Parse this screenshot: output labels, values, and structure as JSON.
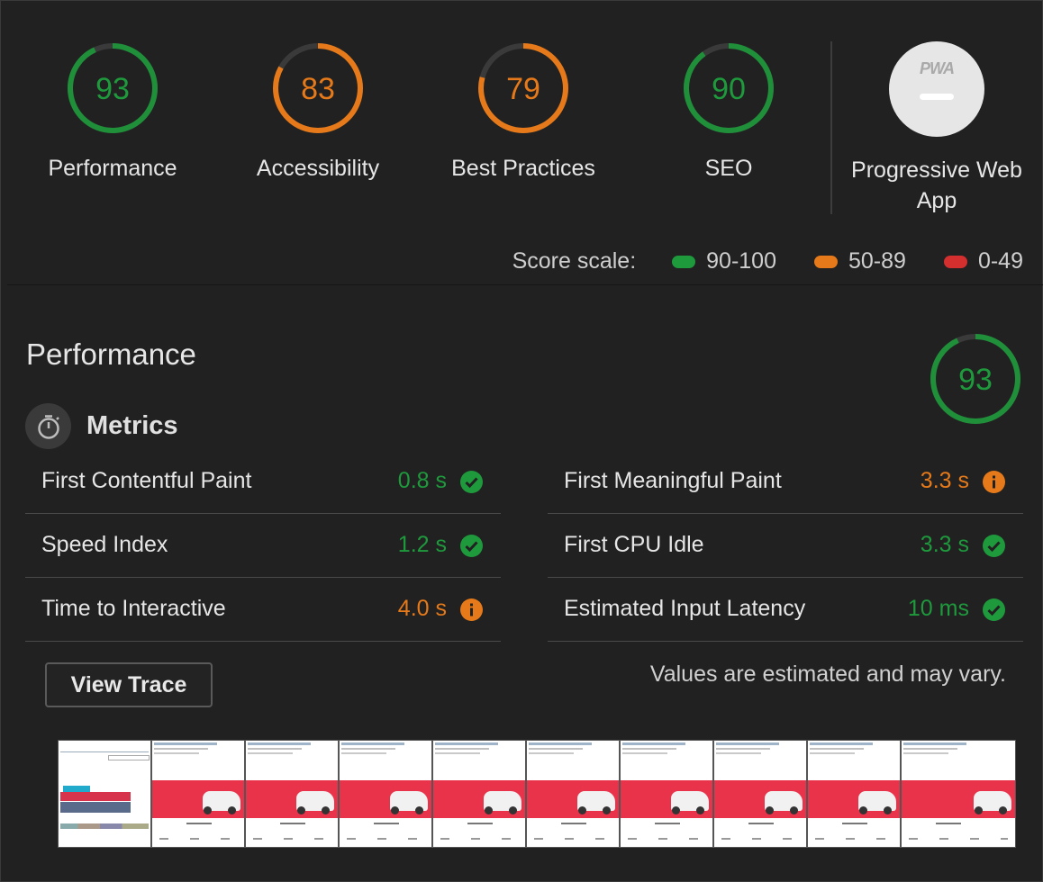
{
  "categories": [
    {
      "label": "Performance",
      "score": "93",
      "value": 93,
      "color": "#1e9a3d",
      "ring": "#1f8f3a"
    },
    {
      "label": "Accessibility",
      "score": "83",
      "value": 83,
      "color": "#e67a1a",
      "ring": "#e67a1a"
    },
    {
      "label": "Best Practices",
      "score": "79",
      "value": 79,
      "color": "#e67a1a",
      "ring": "#e67a1a"
    },
    {
      "label": "SEO",
      "score": "90",
      "value": 90,
      "color": "#1e9a3d",
      "ring": "#1f8f3a"
    }
  ],
  "pwa": {
    "label": "Progressive Web App",
    "badge_text": "PWA"
  },
  "score_scale": {
    "label": "Score scale:",
    "items": [
      {
        "range": "90-100",
        "color": "#1e9a3d"
      },
      {
        "range": "50-89",
        "color": "#e67a1a"
      },
      {
        "range": "0-49",
        "color": "#d32f2f"
      }
    ]
  },
  "performance": {
    "title": "Performance",
    "score": "93",
    "value": 93,
    "metrics_title": "Metrics",
    "metrics_left": [
      {
        "name": "First Contentful Paint",
        "value": "0.8 s",
        "status": "pass"
      },
      {
        "name": "Speed Index",
        "value": "1.2 s",
        "status": "pass"
      },
      {
        "name": "Time to Interactive",
        "value": "4.0 s",
        "status": "average"
      }
    ],
    "metrics_right": [
      {
        "name": "First Meaningful Paint",
        "value": "3.3 s",
        "status": "average"
      },
      {
        "name": "First CPU Idle",
        "value": "3.3 s",
        "status": "pass"
      },
      {
        "name": "Estimated Input Latency",
        "value": "10 ms",
        "status": "pass"
      }
    ],
    "view_trace_label": "View Trace",
    "estimate_note": "Values are estimated and may vary.",
    "filmstrip_frames": 10
  }
}
